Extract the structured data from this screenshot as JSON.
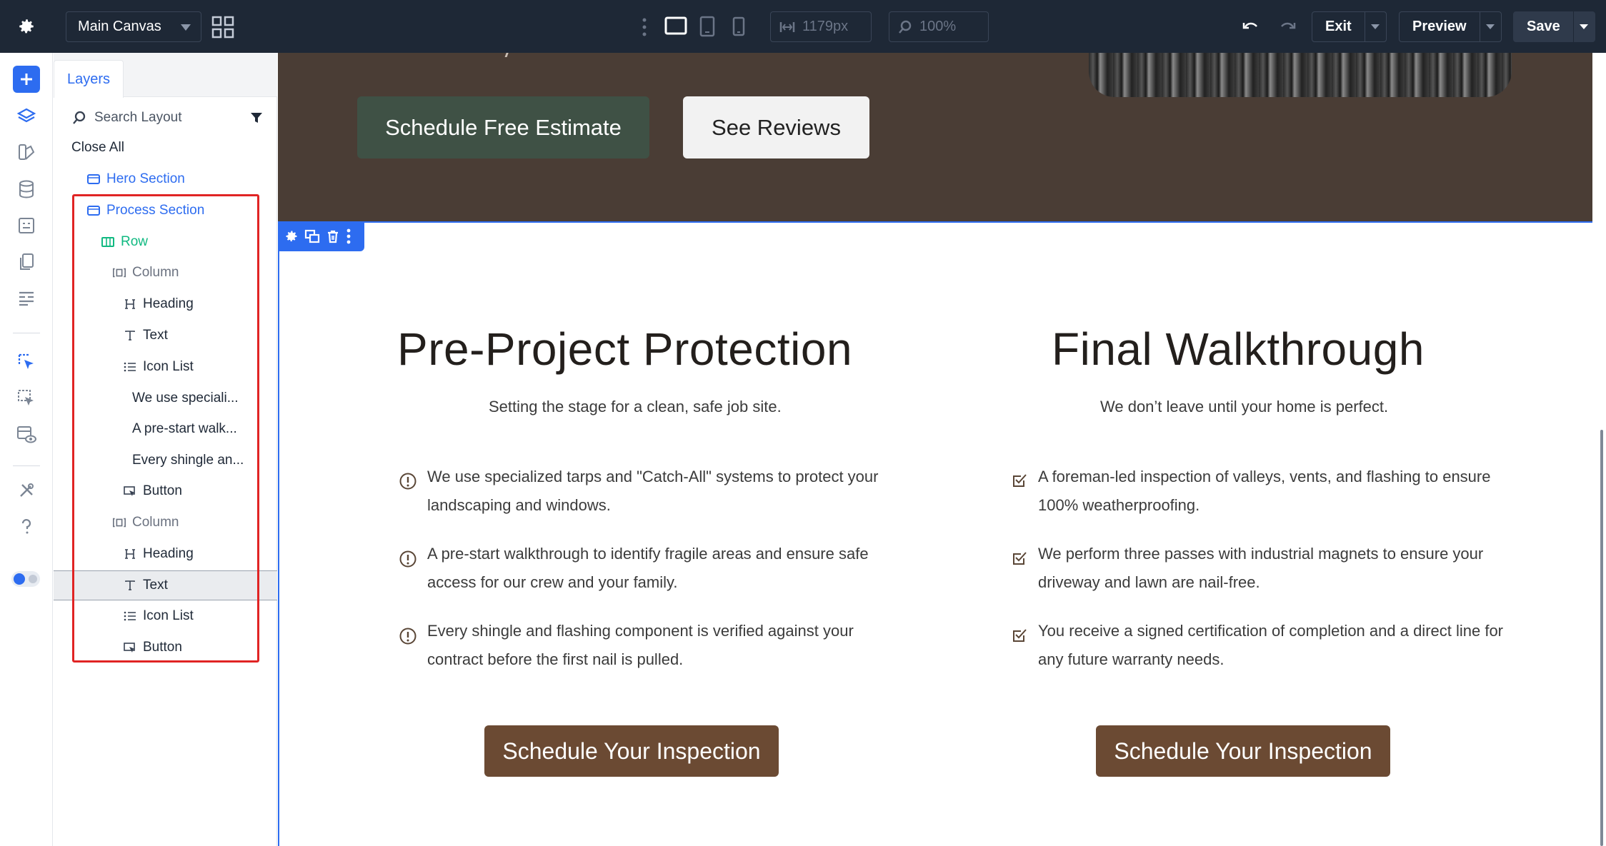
{
  "topbar": {
    "canvas_select": "Main Canvas",
    "width_value": "1179px",
    "zoom_value": "100%",
    "exit_label": "Exit",
    "preview_label": "Preview",
    "save_label": "Save"
  },
  "panel": {
    "tab_label": "Layers",
    "search_placeholder": "Search Layout",
    "close_all": "Close All",
    "layers": [
      {
        "label": "Hero Section",
        "type": "section"
      },
      {
        "label": "Process Section",
        "type": "section"
      },
      {
        "label": "Row",
        "type": "row"
      },
      {
        "label": "Column",
        "type": "column"
      },
      {
        "label": "Heading",
        "type": "heading"
      },
      {
        "label": "Text",
        "type": "text"
      },
      {
        "label": "Icon List",
        "type": "icon-list"
      },
      {
        "label": "We use speciali...",
        "type": "item"
      },
      {
        "label": "A pre-start walk...",
        "type": "item"
      },
      {
        "label": "Every shingle an...",
        "type": "item"
      },
      {
        "label": "Button",
        "type": "button"
      },
      {
        "label": "Column",
        "type": "column"
      },
      {
        "label": "Heading",
        "type": "heading"
      },
      {
        "label": "Text",
        "type": "text"
      },
      {
        "label": "Icon List",
        "type": "icon-list"
      },
      {
        "label": "Button",
        "type": "button"
      }
    ]
  },
  "hero": {
    "primary_button": "Schedule Free Estimate",
    "secondary_button": "See Reviews"
  },
  "process": {
    "left": {
      "heading": "Pre-Project Protection",
      "subtitle": "Setting the stage for a clean, safe job site.",
      "items": [
        "We use specialized tarps and \"Catch-All\" systems to protect your landscaping and windows.",
        "A pre-start walkthrough to identify fragile areas and ensure safe access for our crew and your family.",
        "Every shingle and flashing component is verified against your contract before the first nail is pulled."
      ],
      "button": "Schedule Your Inspection",
      "icon": "alert-circle-icon"
    },
    "right": {
      "heading": "Final Walkthrough",
      "subtitle": "We don’t leave until your home is perfect.",
      "items": [
        "A foreman-led inspection of valleys, vents, and flashing to ensure 100% weatherproofing.",
        "We perform three passes with industrial magnets to ensure your driveway and lawn are nail-free.",
        "You receive a signed certification of completion and a direct line for any future warranty needs."
      ],
      "button": "Schedule Your Inspection",
      "icon": "checkbox-icon"
    }
  },
  "colors": {
    "topbar": "#1e2836",
    "accent": "#2d6cf0",
    "hero_bg": "#4a3d35",
    "hero_primary": "#3f5145",
    "cta": "#6b4a33",
    "highlight": "#e02424"
  }
}
